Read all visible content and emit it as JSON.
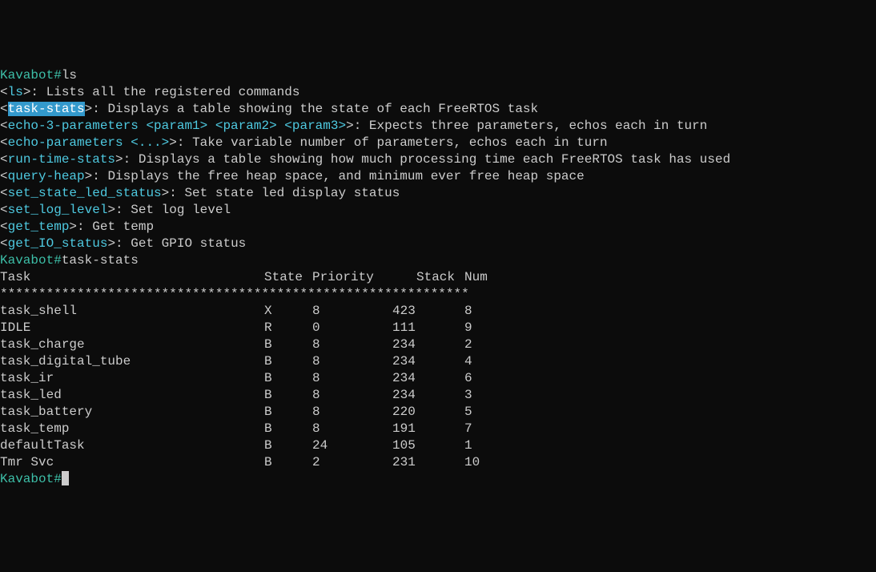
{
  "prompt": "Kavabot#",
  "commands_entered": {
    "first": "ls",
    "second": "task-stats"
  },
  "help": [
    {
      "name": "ls",
      "desc": ": Lists all the registered commands",
      "highlighted": false
    },
    {
      "name": "task-stats",
      "desc": ": Displays a table showing the state of each FreeRTOS task",
      "highlighted": true
    },
    {
      "name": "echo-3-parameters <param1> <param2> <param3>",
      "desc": ": Expects three parameters, echos each in turn",
      "highlighted": false
    },
    {
      "name": "echo-parameters <...>",
      "desc": ": Take variable number of parameters, echos each in turn",
      "highlighted": false
    },
    {
      "name": "run-time-stats",
      "desc": ": Displays a table showing how much processing time each FreeRTOS task has used",
      "highlighted": false
    },
    {
      "name": "query-heap",
      "desc": ": Displays the free heap space, and minimum ever free heap space",
      "highlighted": false
    },
    {
      "name": "set_state_led_status",
      "desc": ": Set state led display status",
      "highlighted": false
    },
    {
      "name": "set_log_level",
      "desc": ": Set log level",
      "highlighted": false
    },
    {
      "name": "get_temp",
      "desc": ": Get temp",
      "highlighted": false
    },
    {
      "name": "get_IO_status",
      "desc": ": Get GPIO status",
      "highlighted": false
    }
  ],
  "table": {
    "headers": {
      "task": "Task",
      "state": "State",
      "priority": "Priority",
      "stack": "Stack",
      "num": "Num"
    },
    "separator": "*************************************************************",
    "rows": [
      {
        "name": "task_shell",
        "state": "X",
        "priority": "8",
        "stack": "423",
        "num": "8"
      },
      {
        "name": "IDLE",
        "state": "R",
        "priority": "0",
        "stack": "111",
        "num": "9"
      },
      {
        "name": "task_charge",
        "state": "B",
        "priority": "8",
        "stack": "234",
        "num": "2"
      },
      {
        "name": "task_digital_tube",
        "state": "B",
        "priority": "8",
        "stack": "234",
        "num": "4"
      },
      {
        "name": "task_ir",
        "state": "B",
        "priority": "8",
        "stack": "234",
        "num": "6"
      },
      {
        "name": "task_led",
        "state": "B",
        "priority": "8",
        "stack": "234",
        "num": "3"
      },
      {
        "name": "task_battery",
        "state": "B",
        "priority": "8",
        "stack": "220",
        "num": "5"
      },
      {
        "name": "task_temp",
        "state": "B",
        "priority": "8",
        "stack": "191",
        "num": "7"
      },
      {
        "name": "defaultTask",
        "state": "B",
        "priority": "24",
        "stack": "105",
        "num": "1"
      },
      {
        "name": "Tmr Svc",
        "state": "B",
        "priority": "2",
        "stack": "231",
        "num": "10"
      }
    ]
  }
}
